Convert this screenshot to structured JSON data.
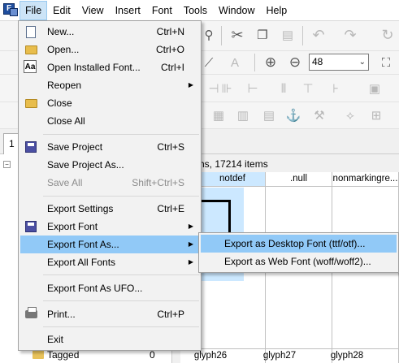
{
  "menubar": {
    "items": [
      "File",
      "Edit",
      "View",
      "Insert",
      "Font",
      "Tools",
      "Window",
      "Help"
    ]
  },
  "toolbar": {
    "zoom_value": "48"
  },
  "file_menu": {
    "items": [
      {
        "label": "New...",
        "shortcut": "Ctrl+N",
        "icon": "new-document-icon"
      },
      {
        "label": "Open...",
        "shortcut": "Ctrl+O",
        "icon": "open-folder-icon"
      },
      {
        "label": "Open Installed Font...",
        "shortcut": "Ctrl+I",
        "icon": "font-aa-icon"
      },
      {
        "label": "Reopen",
        "shortcut": "",
        "icon": ""
      },
      {
        "label": "Close",
        "shortcut": "",
        "icon": "folder-icon"
      },
      {
        "label": "Close All",
        "shortcut": "",
        "icon": ""
      },
      {
        "label": "Save Project",
        "shortcut": "Ctrl+S",
        "icon": "save-disk-icon"
      },
      {
        "label": "Save Project As...",
        "shortcut": "",
        "icon": ""
      },
      {
        "label": "Save All",
        "shortcut": "Shift+Ctrl+S",
        "icon": ""
      },
      {
        "label": "Export Settings",
        "shortcut": "Ctrl+E",
        "icon": ""
      },
      {
        "label": "Export Font",
        "shortcut": "",
        "icon": "export-font-disk-icon"
      },
      {
        "label": "Export Font As...",
        "shortcut": "",
        "icon": ""
      },
      {
        "label": "Export All Fonts",
        "shortcut": "",
        "icon": ""
      },
      {
        "label": "Export Font As UFO...",
        "shortcut": "",
        "icon": ""
      },
      {
        "label": "Print...",
        "shortcut": "Ctrl+P",
        "icon": "printer-icon"
      },
      {
        "label": "Exit",
        "shortcut": "",
        "icon": ""
      }
    ]
  },
  "export_submenu": {
    "items": [
      "Export as Desktop Font (ttf/otf)...",
      "Export as Web Font (woff/woff2)..."
    ]
  },
  "tabs": {
    "first_label": "1"
  },
  "status": {
    "text": "hs, 17214 items"
  },
  "glyph_grid": {
    "headers": [
      "notdef",
      ".null",
      "nonmarkingre..."
    ],
    "footers": [
      "glyph26",
      "glyph27",
      "glyph28"
    ]
  },
  "left_panel": {
    "tagged_label": "Tagged",
    "tagged_count": "0"
  },
  "colors": {
    "menu_highlight": "#91c9f7",
    "selected_cell": "#cce8ff"
  }
}
